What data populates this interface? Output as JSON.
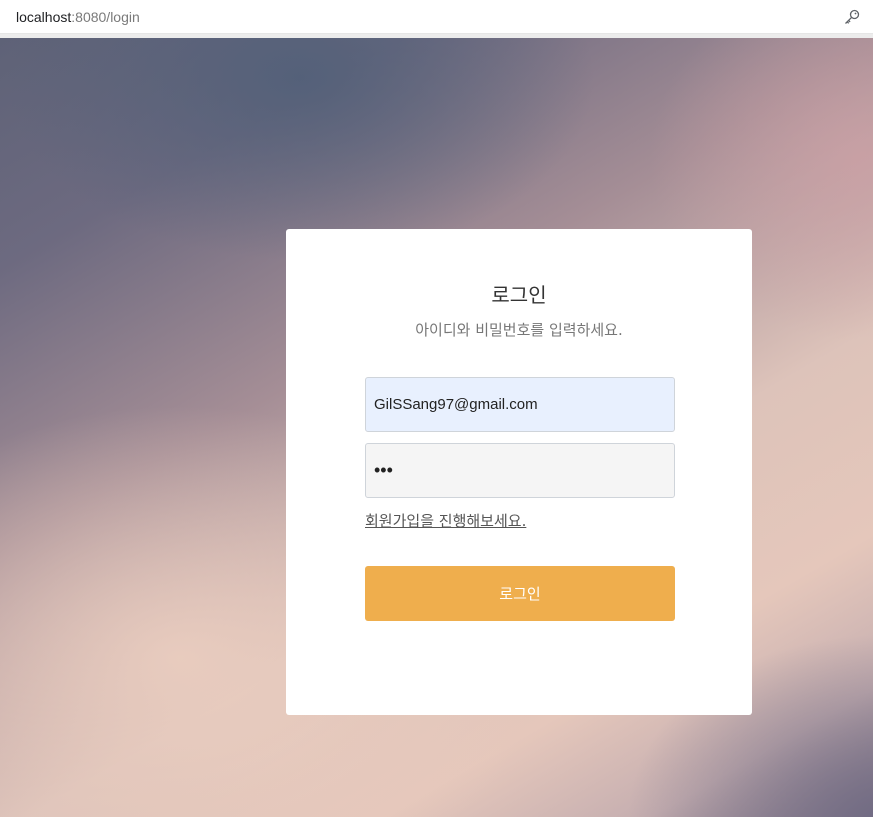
{
  "browser": {
    "url_host": "localhost",
    "url_rest": ":8080/login",
    "key_icon": "key-icon"
  },
  "login": {
    "title": "로그인",
    "subtitle": "아이디와 비밀번호를 입력하세요.",
    "email_value": "GilSSang97@gmail.com",
    "password_value": "•••",
    "signup_link": "회원가입을 진행해보세요.",
    "button_label": "로그인"
  },
  "colors": {
    "button": "#efae4d",
    "email_field_bg": "#e8f0fe",
    "password_field_bg": "#f5f5f5"
  }
}
